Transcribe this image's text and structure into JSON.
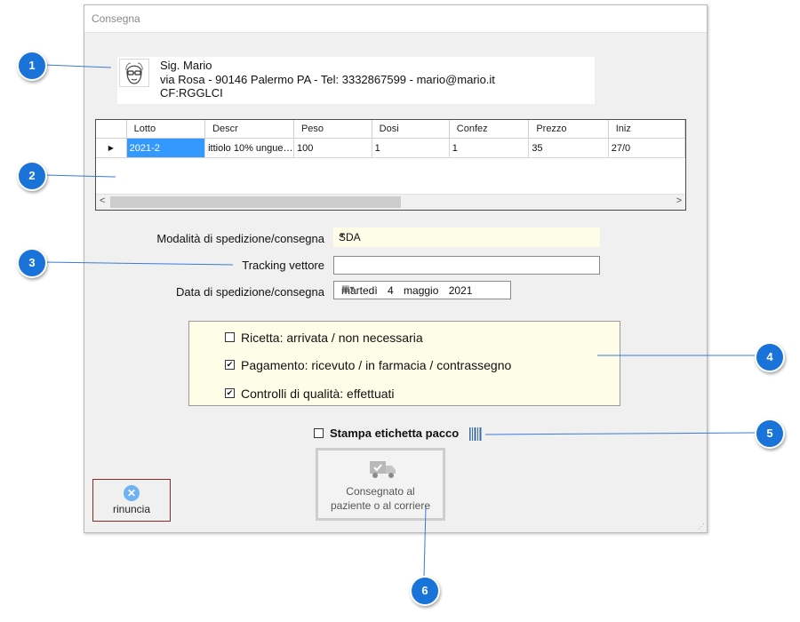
{
  "window": {
    "title": "Consegna"
  },
  "customer": {
    "name": "Sig. Mario",
    "address": "via Rosa - 90146 Palermo PA - Tel:  3332867599 - mario@mario.it",
    "tax_code": "CF:RGGLCI",
    "avatar_icon": "user-face-icon"
  },
  "grid": {
    "columns": [
      "Lotto",
      "Descr",
      "Peso",
      "Dosi",
      "Confez",
      "Prezzo",
      "Iniz"
    ],
    "rows": [
      {
        "indicator": "▶",
        "cells": [
          "2021-2",
          "ittiolo 10% ungue…",
          "100",
          "1",
          "1",
          "35",
          "27/0"
        ]
      }
    ],
    "scroll_left": "<",
    "scroll_right": ">"
  },
  "form": {
    "shipping_mode_label": "Modalità di spedizione/consegna",
    "shipping_mode_value": "SDA",
    "tracking_label": "Tracking  vettore",
    "tracking_value": "",
    "date_label": "Data di spedizione/consegna",
    "date_value": "martedì 4 maggio 2021"
  },
  "checks": [
    {
      "label": "Ricetta: arrivata / non necessaria",
      "checked": false,
      "mark": ""
    },
    {
      "label": "Pagamento: ricevuto /  in farmacia / contrassegno",
      "checked": true,
      "mark": "✔"
    },
    {
      "label": "Controlli di qualità: effettuati",
      "checked": true,
      "mark": "✔"
    }
  ],
  "print_label": {
    "label": "Stampa etichetta pacco",
    "checked": false,
    "icon": "barcode-icon"
  },
  "buttons": {
    "delivered_line1": "Consegnato al",
    "delivered_line2": "paziente o al corriere",
    "delivered_icon": "truck-check-icon",
    "cancel": "rinuncia",
    "cancel_icon": "close-circle-icon",
    "cancel_glyph": "✕"
  },
  "callouts": [
    "1",
    "2",
    "3",
    "4",
    "5",
    "6"
  ],
  "colors": {
    "callout": "#1a73d9",
    "selection": "#3399ff",
    "cancel_border": "#8b2a2a",
    "highlight_bg": "#fefee8"
  }
}
